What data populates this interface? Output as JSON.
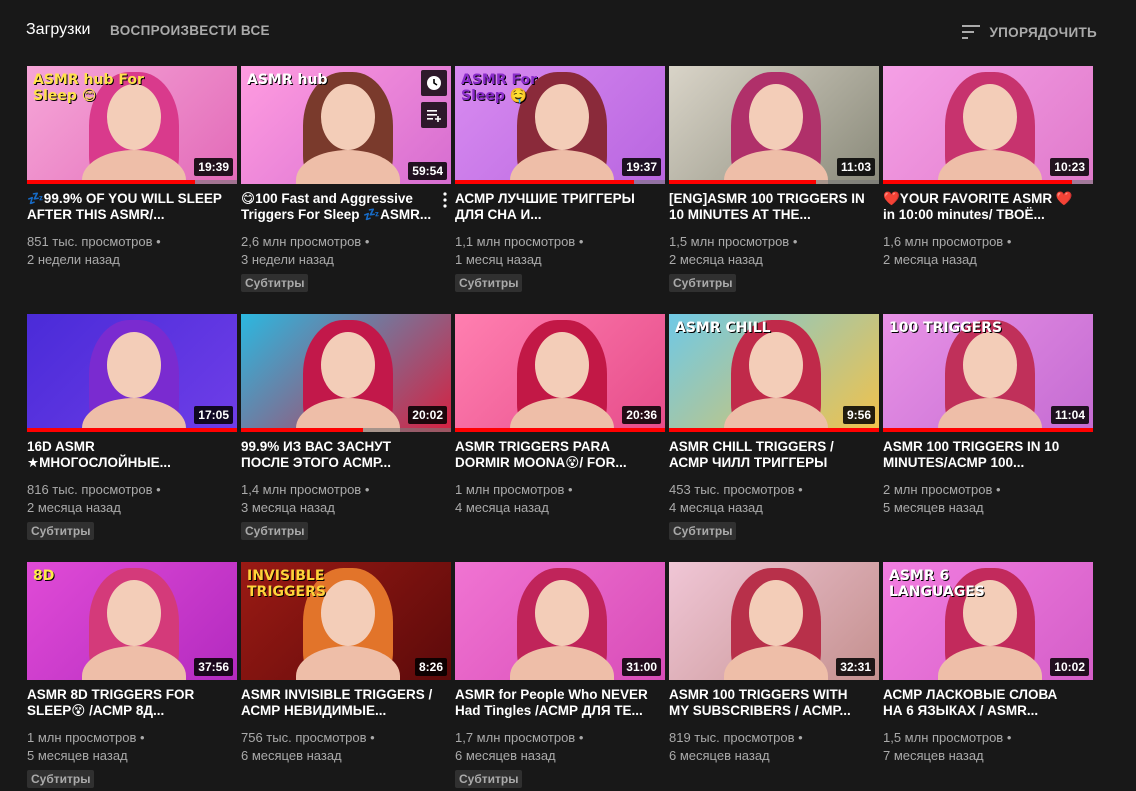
{
  "header": {
    "title": "Загрузки",
    "play_all": "ВОСПРОИЗВЕСТИ ВСЕ",
    "sort_label": "УПОРЯДОЧИТЬ",
    "sort_icon": "sort-icon"
  },
  "videos": [
    {
      "title": "💤99.9% OF YOU WILL SLEEP AFTER THIS ASMR/...",
      "views": "851 тыс. просмотров",
      "age": "2 недели назад",
      "duration": "19:39",
      "subtitles": "",
      "watched": 0.8,
      "bg": [
        "#f6a6d8",
        "#e26ab8"
      ],
      "hair": "#d93a8c",
      "thumb_text": "ASMR hub For Sleep 😊",
      "text_color": "#ffe14d"
    },
    {
      "title": "😋100 Fast and Aggressive Triggers For Sleep 💤ASMR...",
      "views": "2,6 млн просмотров",
      "age": "3 недели назад",
      "duration": "59:54",
      "subtitles": "Субтитры",
      "watched": 0.0,
      "bg": [
        "#ff9ce0",
        "#d66dd0"
      ],
      "hair": "#7a3a2c",
      "thumb_text": "ASMR hub",
      "text_color": "#ffffff"
    },
    {
      "title": "АСМР ЛУЧШИЕ ТРИГГЕРЫ ДЛЯ СНА И...",
      "views": "1,1 млн просмотров",
      "age": "1 месяц назад",
      "duration": "19:37",
      "subtitles": "Субтитры",
      "watched": 0.85,
      "bg": [
        "#d88bf0",
        "#b865e0"
      ],
      "hair": "#8a2a3a",
      "thumb_text": "ASMR For Sleep 🤤",
      "text_color": "#8a2cc9"
    },
    {
      "title": "[ENG]ASMR 100 TRIGGERS IN 10 MINUTES AT THE...",
      "views": "1,5 млн просмотров",
      "age": "2 месяца назад",
      "duration": "11:03",
      "subtitles": "Субтитры",
      "watched": 0.7,
      "bg": [
        "#d9d4c8",
        "#8a8a7a"
      ],
      "hair": "#b0306a",
      "thumb_text": "",
      "text_color": "#ffffff"
    },
    {
      "title": "❤️YOUR FAVORITE ASMR ❤️in 10:00 minutes/ ТВОЁ...",
      "views": "1,6 млн просмотров",
      "age": "2 месяца назад",
      "duration": "10:23",
      "subtitles": "",
      "watched": 0.9,
      "bg": [
        "#f5a0e6",
        "#e07acb"
      ],
      "hair": "#c7336e",
      "thumb_text": "",
      "text_color": "#ffffff"
    },
    {
      "title": "16D ASMR ★МНОГОСЛОЙНЫЕ...",
      "views": "816 тыс. просмотров",
      "age": "2 месяца назад",
      "duration": "17:05",
      "subtitles": "Субтитры",
      "watched": 1.0,
      "bg": [
        "#4a2bd8",
        "#6f3ee8"
      ],
      "hair": "#7a2bd0",
      "thumb_text": "",
      "text_color": "#ffffff"
    },
    {
      "title": "99.9% ИЗ ВАС ЗАСНУТ ПОСЛЕ ЭТОГО АСМР...",
      "views": "1,4 млн просмотров",
      "age": "3 месяца назад",
      "duration": "20:02",
      "subtitles": "Субтитры",
      "watched": 0.58,
      "bg": [
        "#2bb8e0",
        "#d72040"
      ],
      "hair": "#c2184a",
      "thumb_text": "",
      "text_color": "#ffffff"
    },
    {
      "title": "ASMR TRIGGERS PARA DORMIR MOONA😵/ FOR...",
      "views": "1 млн просмотров",
      "age": "4 месяца назад",
      "duration": "20:36",
      "subtitles": "",
      "watched": 1.0,
      "bg": [
        "#ff7fb0",
        "#e64c8a"
      ],
      "hair": "#c21846",
      "thumb_text": "",
      "text_color": "#ffffff"
    },
    {
      "title": "ASMR CHILL TRIGGERS / АСМР ЧИЛЛ ТРИГГЕРЫ",
      "views": "453 тыс. просмотров",
      "age": "4 месяца назад",
      "duration": "9:56",
      "subtitles": "Субтитры",
      "watched": 1.0,
      "bg": [
        "#6fc9e6",
        "#f2c24a"
      ],
      "hair": "#c02a4a",
      "thumb_text": "ASMR CHILL",
      "text_color": "#ffffff"
    },
    {
      "title": "ASMR 100 TRIGGERS IN 10 MINUTES/АСМР 100...",
      "views": "2 млн просмотров",
      "age": "5 месяцев назад",
      "duration": "11:04",
      "subtitles": "",
      "watched": 1.0,
      "bg": [
        "#e892e6",
        "#c46bd2"
      ],
      "hair": "#c0305a",
      "thumb_text": "100 TRIGGERS",
      "text_color": "#ffffff"
    },
    {
      "title": "ASMR 8D TRIGGERS FOR SLEEP😵 /АСМР 8Д...",
      "views": "1 млн просмотров",
      "age": "5 месяцев назад",
      "duration": "37:56",
      "subtitles": "Субтитры",
      "watched": 0.0,
      "bg": [
        "#e04bd6",
        "#b32ac0"
      ],
      "hair": "#d43a7a",
      "thumb_text": "8D",
      "text_color": "#ffe94a"
    },
    {
      "title": "ASMR INVISIBLE TRIGGERS / АСМР НЕВИДИМЫЕ...",
      "views": "756 тыс. просмотров",
      "age": "6 месяцев назад",
      "duration": "8:26",
      "subtitles": "",
      "watched": 0.0,
      "bg": [
        "#9a1a14",
        "#5c0a0a"
      ],
      "hair": "#e2742a",
      "thumb_text": "INVISIBLE TRIGGERS",
      "text_color": "#ffd23a"
    },
    {
      "title": "ASMR for People Who NEVER Had Tingles /АСМР ДЛЯ ТЕ...",
      "views": "1,7 млн просмотров",
      "age": "6 месяцев назад",
      "duration": "31:00",
      "subtitles": "Субтитры",
      "watched": 0.0,
      "bg": [
        "#f074d2",
        "#d84cb8"
      ],
      "hair": "#c0245a",
      "thumb_text": "",
      "text_color": "#ffffff"
    },
    {
      "title": "ASMR 100 TRIGGERS WITH MY SUBSCRIBERS / АСМР...",
      "views": "819 тыс. просмотров",
      "age": "6 месяцев назад",
      "duration": "32:31",
      "subtitles": "",
      "watched": 0.0,
      "bg": [
        "#f0c6d6",
        "#c4908e"
      ],
      "hair": "#b8304a",
      "thumb_text": "",
      "text_color": "#ffffff"
    },
    {
      "title": "АСМР ЛАСКОВЫЕ СЛОВА НА 6 ЯЗЫКАХ / ASMR...",
      "views": "1,5 млн просмотров",
      "age": "7 месяцев назад",
      "duration": "10:02",
      "subtitles": "",
      "watched": 0.0,
      "bg": [
        "#f27ee0",
        "#d45ec8"
      ],
      "hair": "#c22a5c",
      "thumb_text": "ASMR 6 LANGUAGES",
      "text_color": "#ffffff"
    }
  ]
}
